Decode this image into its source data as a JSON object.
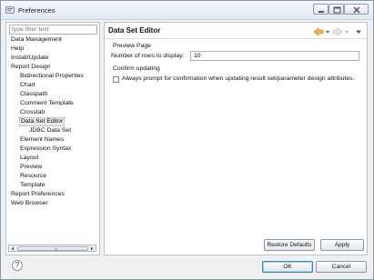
{
  "window": {
    "title": "Preferences"
  },
  "filter": {
    "placeholder": "type filter text"
  },
  "tree": [
    {
      "label": "Data Management",
      "level": 0,
      "selected": false
    },
    {
      "label": "Help",
      "level": 0,
      "selected": false
    },
    {
      "label": "Install/Update",
      "level": 0,
      "selected": false
    },
    {
      "label": "Report Design",
      "level": 0,
      "selected": false
    },
    {
      "label": "Bidirectional Properties",
      "level": 1,
      "selected": false
    },
    {
      "label": "Chart",
      "level": 1,
      "selected": false
    },
    {
      "label": "Classpath",
      "level": 1,
      "selected": false
    },
    {
      "label": "Comment Template",
      "level": 1,
      "selected": false
    },
    {
      "label": "Crosstab",
      "level": 1,
      "selected": false
    },
    {
      "label": "Data Set Editor",
      "level": 1,
      "selected": true
    },
    {
      "label": "JDBC Data Set",
      "level": 2,
      "selected": false
    },
    {
      "label": "Element Names",
      "level": 1,
      "selected": false
    },
    {
      "label": "Expression Syntax",
      "level": 1,
      "selected": false
    },
    {
      "label": "Layout",
      "level": 1,
      "selected": false
    },
    {
      "label": "Preview",
      "level": 1,
      "selected": false
    },
    {
      "label": "Resource",
      "level": 1,
      "selected": false
    },
    {
      "label": "Template",
      "level": 1,
      "selected": false
    },
    {
      "label": "Report Preferences",
      "level": 0,
      "selected": false
    },
    {
      "label": "Web Browser",
      "level": 0,
      "selected": false
    }
  ],
  "page": {
    "title": "Data Set Editor",
    "preview_section": "Preview Page",
    "rows_label": "Number of rows to display:",
    "rows_value": "10",
    "confirm_section": "Confirm updating",
    "confirm_checkbox_label": "Always prompt for confirmation when updating result set/parameter design attributes.",
    "confirm_checked": false
  },
  "buttons": {
    "restore_defaults": "Restore Defaults",
    "apply": "Apply",
    "ok": "OK",
    "cancel": "Cancel"
  },
  "help_glyph": "?",
  "icons": {
    "back": "back-arrow-icon",
    "forward": "forward-arrow-icon",
    "menu": "view-menu-icon",
    "accent_back": "#e8a23a"
  }
}
